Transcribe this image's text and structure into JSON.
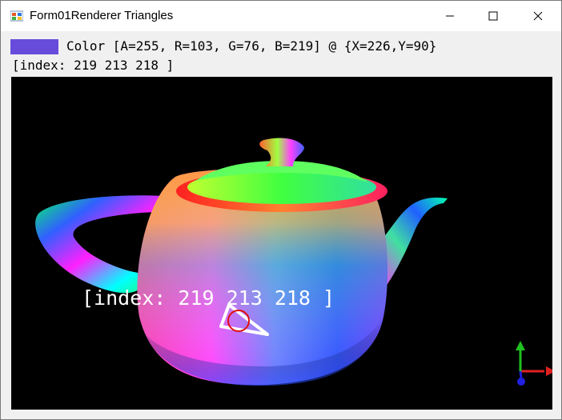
{
  "window": {
    "title": "Form01Renderer Triangles",
    "icon": "winforms-app-icon",
    "controls": [
      "minimize-icon",
      "maximize-icon",
      "close-icon"
    ]
  },
  "picked": {
    "swatch_color": "#674CDB",
    "color_text": "Color [A=255, R=103, G=76, B=219] @ {X=226,Y=90}",
    "index_text": "[index: 219 213 218 ]"
  },
  "viewport": {
    "background": "#000000",
    "model": "teapot",
    "overlay_text": "[index: 219 213 218 ]",
    "axis_colors": {
      "x": "#e02020",
      "y": "#20c020",
      "z": "#2020e0"
    }
  }
}
